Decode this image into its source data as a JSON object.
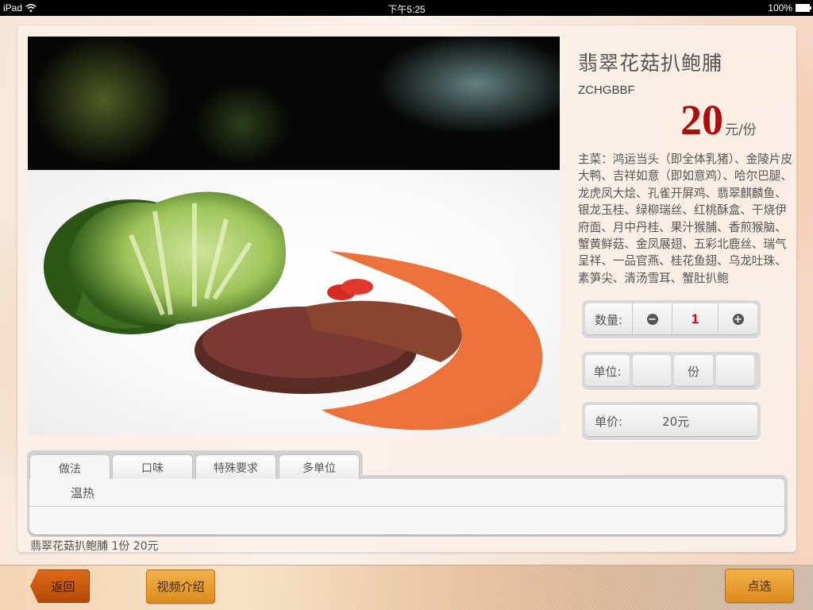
{
  "status_bar": {
    "device": "iPad",
    "time": "下午5:25",
    "battery": "100%"
  },
  "dish": {
    "name": "翡翠花菇扒鲍脯",
    "code": "ZCHGBBF",
    "price": "20",
    "price_unit": "元/份",
    "description": "主菜：鸿运当头（即全体乳猪）、金陵片皮大鸭、吉祥如意（即如意鸡）、哈尔巴腿、龙虎凤大烩、孔雀开屏鸡、翡翠麒麟鱼、银龙玉桂、绿柳瑞丝、红桃酥盒、干烧伊府面、月中丹桂、果汁猴脯、香煎猴脑、蟹黄鲜菇、金凤展翅、五彩北鹿丝、瑞气呈祥、一品官燕、桂花鱼翅、乌龙吐珠、素笋尖、清汤雪耳、蟹肚扒鲍"
  },
  "controls": {
    "quantity": {
      "label": "数量:",
      "decrement_icon": "minus-circle-icon",
      "value": "1",
      "increment_icon": "plus-circle-icon"
    },
    "unit": {
      "label": "单位:",
      "options": [
        "",
        "份",
        ""
      ]
    },
    "unit_price": {
      "label": "单价:",
      "value": "20元"
    }
  },
  "tabs": {
    "items": [
      {
        "label": "做法",
        "active": true
      },
      {
        "label": "口味",
        "active": false
      },
      {
        "label": "特殊要求",
        "active": false
      },
      {
        "label": "多单位",
        "active": false
      }
    ],
    "panel_options": [
      "温热",
      ""
    ]
  },
  "summary": "翡翠花菇扒鲍脯 1份 20元",
  "bottom_bar": {
    "back_label": "返回",
    "video_label": "视频介绍",
    "select_label": "点选"
  },
  "colors": {
    "price_red": "#b00a0a",
    "quantity_red": "#cc0000",
    "button_orange": "#e59a2c",
    "back_button": "#c7530f"
  }
}
